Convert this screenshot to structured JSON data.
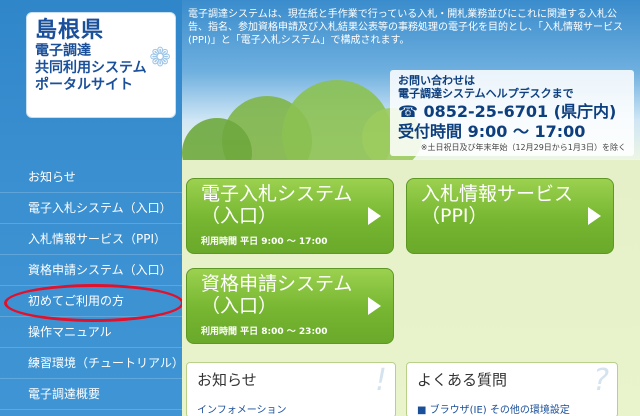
{
  "logo": {
    "prefecture": "島根県",
    "lines": [
      "電子調達",
      "共同利用システム",
      "ポータルサイト"
    ]
  },
  "intro_text": "電子調達システムは、現在紙と手作業で行っている入札・開札業務並びにこれに関連する入札公告、指名、参加資格申請及び入札結果公表等の事務処理の電子化を目的とし、「入札情報サービス(PPI)」と「電子入札システム」で構成されます。",
  "contact": {
    "heading1": "お問い合わせは",
    "heading2": "電子調達システムヘルプデスクまで",
    "phone": "☎ 0852-25-6701 (県庁内)",
    "hours": "受付時間 9:00 〜 17:00",
    "note": "※土日祝日及び年末年始（12月29日から1月3日）を除く"
  },
  "nav": [
    "お知らせ",
    "電子入札システム（入口）",
    "入札情報サービス（PPI）",
    "資格申請システム（入口）",
    "初めてご利用の方",
    "操作マニュアル",
    "練習環境（チュートリアル）",
    "電子調達概要"
  ],
  "systems": [
    {
      "title1": "電子入札システム",
      "title2": "（入口）",
      "hours": "利用時間 平日 9:00 〜 17:00"
    },
    {
      "title1": "入札情報サービス",
      "title2": "（PPI）",
      "hours": ""
    },
    {
      "title1": "資格申請システム",
      "title2": "（入口）",
      "hours": "利用時間 平日 8:00 〜 23:00"
    }
  ],
  "panels": {
    "news_title": "お知らせ",
    "news_line": "インフォメーション",
    "faq_title": "よくある質問",
    "faq_line": "■ ブラウザ(IE) その他の環境設定"
  },
  "colors": {
    "sidebar": "#3a8fd0",
    "accent_green": "#76b631",
    "highlight": "#e2102a"
  }
}
